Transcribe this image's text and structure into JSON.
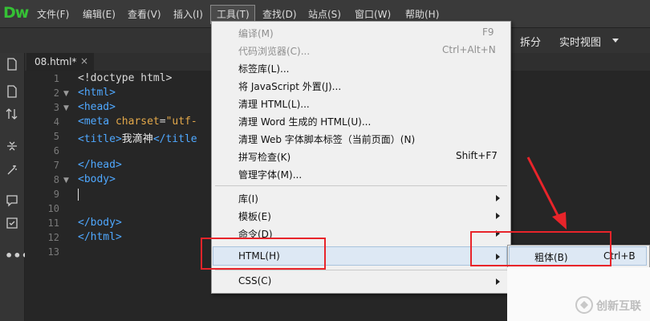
{
  "app": {
    "logo": "Dw"
  },
  "menubar": {
    "items": [
      "文件(F)",
      "编辑(E)",
      "查看(V)",
      "插入(I)",
      "工具(T)",
      "查找(D)",
      "站点(S)",
      "窗口(W)",
      "帮助(H)"
    ]
  },
  "toolbar": {
    "split_label": "拆分",
    "live_view_label": "实时视图"
  },
  "tab": {
    "filename": "08.html*",
    "close": "×"
  },
  "editor": {
    "line_numbers": [
      "1",
      "2",
      "3",
      "4",
      "5",
      "6",
      "7",
      "8",
      "9",
      "10",
      "11",
      "12",
      "13"
    ],
    "lines": {
      "l1": "<!doctype html>",
      "l2": "<html>",
      "l3": "<head>",
      "l4_tag": "<meta ",
      "l4_attr": "charset",
      "l4_eq": "=",
      "l4_str": "\"utf-",
      "l5_open": "<title>",
      "l5_text": "我滴神",
      "l5_close": "</title",
      "l7": "</head>",
      "l8": "<body>",
      "l11": "</body>",
      "l12": "</html>"
    }
  },
  "tools_menu": {
    "items": {
      "compile": "编译(M)",
      "compile_sc": "F9",
      "code_browser": "代码浏览器(C)...",
      "code_browser_sc": "Ctrl+Alt+N",
      "tag_library": "标签库(L)...",
      "externalize_js": "将 JavaScript 外置(J)...",
      "clean_html": "清理 HTML(L)...",
      "clean_word": "清理 Word 生成的 HTML(U)...",
      "clean_web_fonts": "清理 Web 字体脚本标签（当前页面）(N)",
      "spell_check": "拼写检查(K)",
      "spell_check_sc": "Shift+F7",
      "manage_fonts": "管理字体(M)...",
      "library": "库(I)",
      "templates": "模板(E)",
      "commands": "命令(D)",
      "html": "HTML(H)",
      "css": "CSS(C)"
    }
  },
  "html_submenu": {
    "bold": "粗体(B)",
    "bold_sc": "Ctrl+B"
  },
  "watermark": {
    "text": "创新互联"
  },
  "colors": {
    "accent_red": "#e8242a",
    "logo_green": "#35c135",
    "tag_blue": "#4fa8ff",
    "attr_orange": "#e3a84a"
  }
}
